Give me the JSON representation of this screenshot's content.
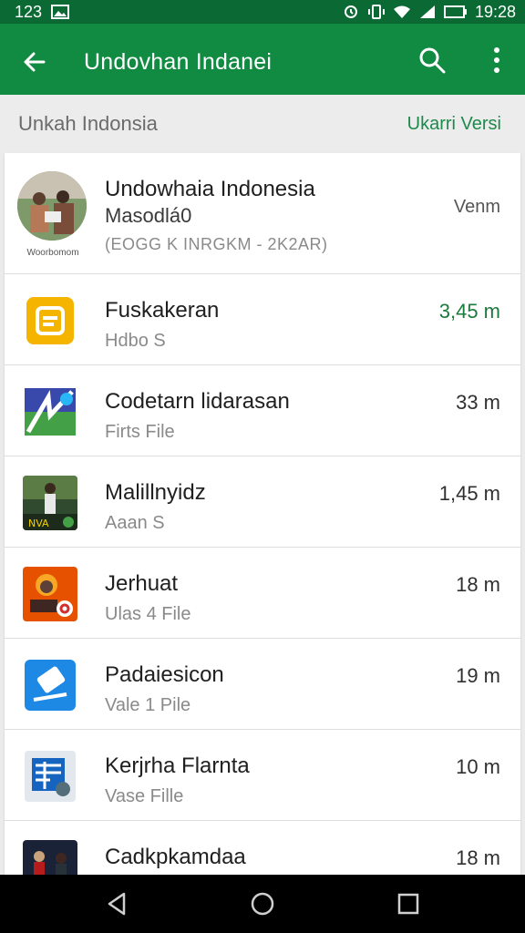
{
  "status_bar": {
    "time_left": "123",
    "time_right": "19:28"
  },
  "app_bar": {
    "title": "Undovhan Indanei"
  },
  "header": {
    "left": "Unkah Indonsia",
    "right": "Ukarri Versi"
  },
  "featured": {
    "title": "Undowhaia  Indonesia",
    "subtitle": "Masodlá0",
    "meta": "(EOGG K INRGKM - 2K2AR)",
    "caption": "Woorbomom",
    "action": "Venm"
  },
  "items": [
    {
      "title": "Fuskakeran",
      "subtitle": "Hdbo S",
      "size": "3,45 m",
      "highlight": true
    },
    {
      "title": "Codetarn lidarasan",
      "subtitle": "Firts File",
      "size": "33 m"
    },
    {
      "title": "Malillnyidz",
      "subtitle": "Aaan S",
      "size": "1,45 m"
    },
    {
      "title": "Jerhuat",
      "subtitle": "Ulas 4 File",
      "size": "18 m"
    },
    {
      "title": "Padaiesicon",
      "subtitle": "Vale 1 Pile",
      "size": "19 m"
    },
    {
      "title": "Kerjrha Flarnta",
      "subtitle": "Vase Fille",
      "size": "10 m"
    },
    {
      "title": "Cadkpkamdaa",
      "subtitle": "",
      "size": "18 m"
    }
  ],
  "icons": {
    "back": "arrow-back-icon",
    "search": "search-icon",
    "more": "more-vert-icon",
    "nav_back": "nav-back-icon",
    "nav_home": "nav-home-icon",
    "nav_recents": "nav-recents-icon"
  },
  "colors": {
    "status_bar": "#0b6a33",
    "app_bar": "#118a42",
    "accent_text": "#1d8a4b"
  }
}
